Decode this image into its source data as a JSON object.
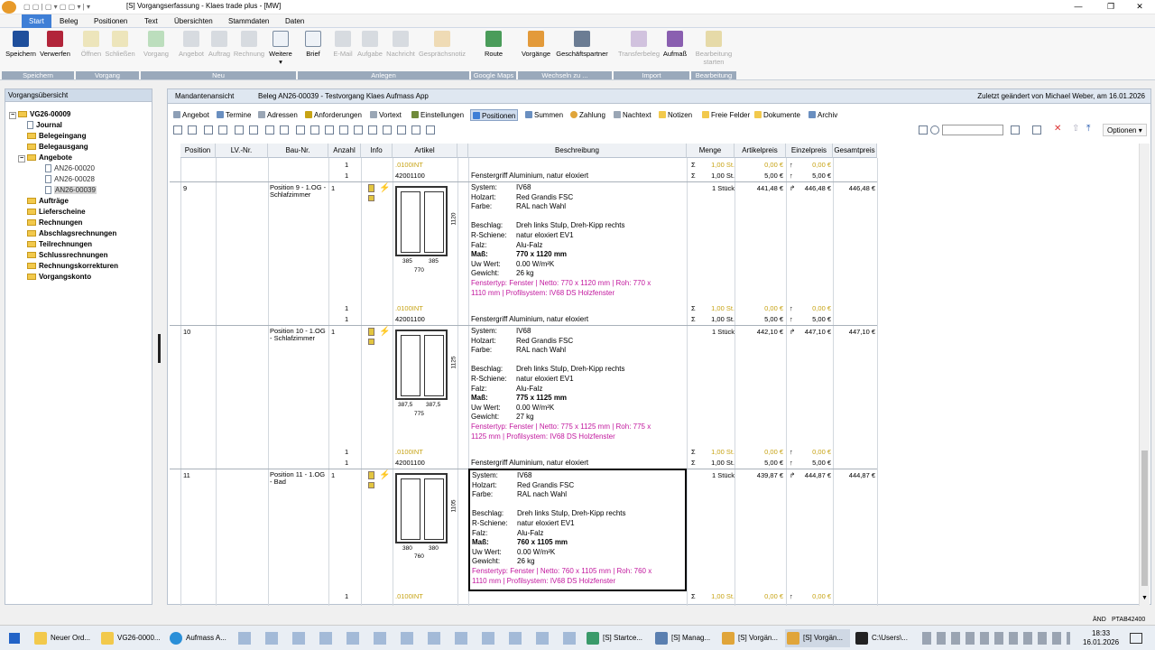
{
  "window": {
    "title": "[S] Vorgangserfassung - Klaes trade plus - [MW]",
    "menu_tabs": [
      "Start",
      "Beleg",
      "Positionen",
      "Text",
      "Übersichten",
      "Stammdaten",
      "Daten"
    ]
  },
  "ribbon": {
    "speichern": "Speichern",
    "verwerfen": "Verwerfen",
    "oeffnen": "Öffnen",
    "schliessen": "Schließen",
    "vorgang": "Vorgang",
    "angebot": "Angebot",
    "auftrag": "Auftrag",
    "rechnung": "Rechnung",
    "weitere": "Weitere",
    "brief": "Brief",
    "email": "E-Mail",
    "aufgabe": "Aufgabe",
    "nachricht": "Nachricht",
    "gespraechsnotiz": "Gesprächsnotiz",
    "route": "Route",
    "vorgaenge": "Vorgänge",
    "geschaeftspartner": "Geschäftspartner",
    "transferbeleg": "Transferbeleg",
    "aufmass": "Aufmaß",
    "bearbeitung_starten": "Bearbeitung starten",
    "groups": [
      "Speichern",
      "Vorgang",
      "Neu",
      "Anlegen",
      "Google Maps",
      "Wechseln zu ...",
      "Import",
      "Bearbeitung"
    ]
  },
  "left_panel": {
    "header": "Vorgangsübersicht",
    "root": "VG26-00009",
    "items": [
      "Journal",
      "Belegeingang",
      "Belegausgang",
      "Angebote",
      "AN26-00020",
      "AN26-00028",
      "AN26-00039",
      "Aufträge",
      "Lieferscheine",
      "Rechnungen",
      "Abschlagsrechnungen",
      "Teilrechnungen",
      "Schlussrechnungen",
      "Rechnungskorrekturen",
      "Vorgangskonto"
    ]
  },
  "main_header": {
    "view": "Mandantenansicht",
    "beleg": "Beleg AN26-00039 - Testvorgang Klaes Aufmass App",
    "changed": "Zuletzt geändert von Michael Weber, am 16.01.2026"
  },
  "sub_tabs": [
    "Angebot",
    "Termine",
    "Adressen",
    "Anforderungen",
    "Vortext",
    "Einstellungen",
    "Positionen",
    "Summen",
    "Zahlung",
    "Nachtext",
    "Notizen",
    "Freie Felder",
    "Dokumente",
    "Archiv"
  ],
  "options_label": "Optionen",
  "columns": [
    "Position",
    "LV.-Nr.",
    "Bau-Nr.",
    "Anzahl",
    "Info",
    "Artikel",
    "Beschreibung",
    "Menge",
    "Artikelpreis",
    "Einzelpreis",
    "Gesamtpreis"
  ],
  "labels": {
    "system": "System:",
    "holzart": "Holzart:",
    "farbe": "Farbe:",
    "beschlag": "Beschlag:",
    "rschiene": "R-Schiene:",
    "falz": "Falz:",
    "mass": "Maß:",
    "uw": "Uw Wert:",
    "gewicht": "Gewicht:"
  },
  "top_sub": [
    {
      "anzahl": "1",
      "artikel": ".0100INT",
      "menge": "1,00 St.",
      "artikelpreis": "0,00 €",
      "einzelpreis": "0,00 €"
    },
    {
      "anzahl": "1",
      "artikel": "42001100",
      "beschreibung": "Fenstergriff Aluminium, natur eloxiert",
      "menge": "1,00 St.",
      "artikelpreis": "5,00 €",
      "einzelpreis": "5,00 €"
    }
  ],
  "positions": [
    {
      "position": "9",
      "bau": "Position 9 - 1.OG - Schlafzimmer",
      "anzahl": "1",
      "system": "IV68",
      "holzart": "Red Grandis FSC",
      "farbe": "RAL nach Wahl",
      "beschlag": "Dreh links Stulp, Dreh-Kipp rechts",
      "rschiene": "natur eloxiert EV1",
      "falz": "Alu-Falz",
      "mass": "770 x 1120 mm",
      "uw": "0.00 W/m²K",
      "gewicht": "26 kg",
      "fenstertyp1": "Fenstertyp: Fenster | Netto: 770 x 1120 mm | Roh: 770 x",
      "fenstertyp2": "1110 mm | Profilsystem: IV68 DS Holzfenster",
      "menge": "1 Stück",
      "artikelpreis": "441,48 €",
      "einzelpreis": "446,48 €",
      "gesamtpreis": "446,48 €",
      "dim_left": "385",
      "dim_right": "385",
      "dim_total": "770",
      "dim_height": "1120",
      "sub": [
        {
          "anzahl": "1",
          "artikel": ".0100INT",
          "menge": "1,00 St.",
          "artikelpreis": "0,00 €",
          "einzelpreis": "0,00 €"
        },
        {
          "anzahl": "1",
          "artikel": "42001100",
          "beschreibung": "Fenstergriff Aluminium, natur eloxiert",
          "menge": "1,00 St.",
          "artikelpreis": "5,00 €",
          "einzelpreis": "5,00 €"
        }
      ]
    },
    {
      "position": "10",
      "bau": "Position 10 - 1.OG - Schlafzimmer",
      "anzahl": "1",
      "system": "IV68",
      "holzart": "Red Grandis FSC",
      "farbe": "RAL nach Wahl",
      "beschlag": "Dreh links Stulp, Dreh-Kipp rechts",
      "rschiene": "natur eloxiert EV1",
      "falz": "Alu-Falz",
      "mass": "775 x 1125 mm",
      "uw": "0.00 W/m²K",
      "gewicht": "27 kg",
      "fenstertyp1": "Fenstertyp: Fenster | Netto: 775 x 1125 mm | Roh: 775 x",
      "fenstertyp2": "1125 mm | Profilsystem: IV68 DS Holzfenster",
      "menge": "1 Stück",
      "artikelpreis": "442,10 €",
      "einzelpreis": "447,10 €",
      "gesamtpreis": "447,10 €",
      "dim_left": "387,5",
      "dim_right": "387,5",
      "dim_total": "775",
      "dim_height": "1125",
      "sub": [
        {
          "anzahl": "1",
          "artikel": ".0100INT",
          "menge": "1,00 St.",
          "artikelpreis": "0,00 €",
          "einzelpreis": "0,00 €"
        },
        {
          "anzahl": "1",
          "artikel": "42001100",
          "beschreibung": "Fenstergriff Aluminium, natur eloxiert",
          "menge": "1,00 St.",
          "artikelpreis": "5,00 €",
          "einzelpreis": "5,00 €"
        }
      ]
    },
    {
      "position": "11",
      "bau": "Position 11 - 1.OG - Bad",
      "anzahl": "1",
      "system": "IV68",
      "holzart": "Red Grandis FSC",
      "farbe": "RAL nach Wahl",
      "beschlag": "Dreh links Stulp, Dreh-Kipp rechts",
      "rschiene": "natur eloxiert EV1",
      "falz": "Alu-Falz",
      "mass": "760 x 1105 mm",
      "uw": "0.00 W/m²K",
      "gewicht": "26 kg",
      "fenstertyp1": "Fenstertyp: Fenster | Netto: 760 x 1105 mm | Roh: 760 x",
      "fenstertyp2": "1110 mm | Profilsystem: IV68 DS Holzfenster",
      "menge": "1 Stück",
      "artikelpreis": "439,87 €",
      "einzelpreis": "444,87 €",
      "gesamtpreis": "444,87 €",
      "dim_left": "380",
      "dim_right": "380",
      "dim_total": "760",
      "dim_height": "1105",
      "sub": [
        {
          "anzahl": "1",
          "artikel": ".0100INT",
          "menge": "1,00 St.",
          "artikelpreis": "0,00 €",
          "einzelpreis": "0,00 €"
        }
      ]
    }
  ],
  "status": {
    "mode": "ÄND",
    "code": "PTAB42400"
  },
  "taskbar": {
    "items": [
      "Neuer Ord...",
      "VG26-0000...",
      "Aufmass A...",
      "[S] Startce...",
      "[S] Manag...",
      "[S] Vorgän...",
      "[S] Vorgän...",
      "C:\\Users\\..."
    ],
    "time": "18:33",
    "date": "16.01.2026"
  },
  "colors": {
    "accent": "#3f7fd6",
    "pink": "#c2189e",
    "gold": "#c7a314"
  }
}
